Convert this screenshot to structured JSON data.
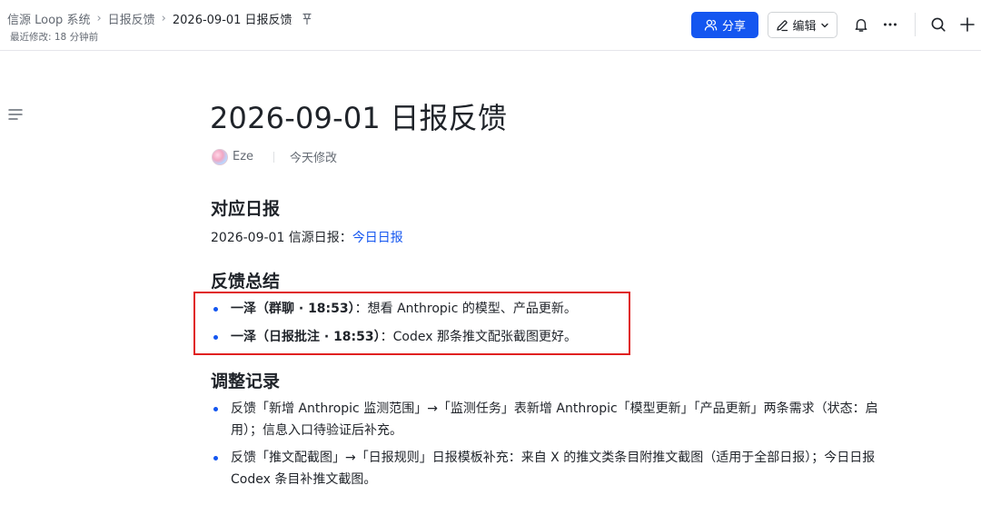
{
  "header": {
    "breadcrumb": [
      "信源 Loop 系统",
      "日报反馈",
      "2026-09-01 日报反馈"
    ],
    "last_modified": "最近修改: 18 分钟前",
    "share_label": "分享",
    "edit_label": "编辑"
  },
  "doc": {
    "title": "2026-09-01 日报反馈",
    "author": "Eze",
    "modified": "今天修改",
    "sections": {
      "report": {
        "heading": "对应日报",
        "text": "2026-09-01 信源日报：",
        "link": "今日日报"
      },
      "summary": {
        "heading": "反馈总结",
        "items": [
          {
            "bold": "一泽（群聊 · 18:53）",
            "text": "：想看 Anthropic 的模型、产品更新。"
          },
          {
            "bold": "一泽（日报批注 · 18:53）",
            "text": "：Codex 那条推文配张截图更好。"
          }
        ]
      },
      "changes": {
        "heading": "调整记录",
        "items": [
          "反馈「新增 Anthropic 监测范围」→「监测任务」表新增 Anthropic「模型更新」「产品更新」两条需求（状态：启用）；信息入口待验证后补充。",
          "反馈「推文配截图」→「日报规则」日报模板补充：来自 X 的推文类条目附推文截图（适用于全部日报）；今日日报 Codex 条目补推文截图。"
        ]
      }
    }
  },
  "colors": {
    "accent": "#1456f0",
    "highlight_border": "#e02020"
  },
  "icons": [
    "pin-icon",
    "share-people-icon",
    "pencil-icon",
    "chevron-down-icon",
    "bell-icon",
    "more-icon",
    "search-icon",
    "plus-icon",
    "toc-list-icon",
    "avatar"
  ]
}
